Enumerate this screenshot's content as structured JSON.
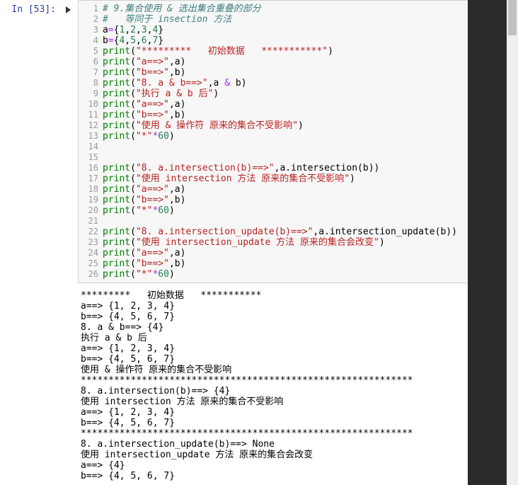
{
  "prompt": {
    "label": "In [53]:"
  },
  "code_lines": [
    {
      "n": "1",
      "html": "<span class='c'># 9.集合使用 &amp; 选出集合重叠的部分</span>"
    },
    {
      "n": "2",
      "html": "<span class='c'>#   等同于 insection 方法</span>"
    },
    {
      "n": "3",
      "html": "<span class='n'>a</span><span class='o'>=</span><span class='p'>{</span><span class='mi'>1</span><span class='p'>,</span><span class='mi'>2</span><span class='p'>,</span><span class='mi'>3</span><span class='p'>,</span><span class='mi'>4</span><span class='p'>}</span>"
    },
    {
      "n": "4",
      "html": "<span class='n'>b</span><span class='o'>=</span><span class='p'>{</span><span class='mi'>4</span><span class='p'>,</span><span class='mi'>5</span><span class='p'>,</span><span class='mi'>6</span><span class='p'>,</span><span class='mi'>7</span><span class='p'>}</span>"
    },
    {
      "n": "5",
      "html": "<span class='bp'>print</span><span class='p'>(</span><span class='s'>\"*********   初始数据   ***********\"</span><span class='p'>)</span>"
    },
    {
      "n": "6",
      "html": "<span class='bp'>print</span><span class='p'>(</span><span class='s'>\"a==&gt;\"</span><span class='p'>,</span><span class='n'>a</span><span class='p'>)</span>"
    },
    {
      "n": "7",
      "html": "<span class='bp'>print</span><span class='p'>(</span><span class='s'>\"b==&gt;\"</span><span class='p'>,</span><span class='n'>b</span><span class='p'>)</span>"
    },
    {
      "n": "8",
      "html": "<span class='bp'>print</span><span class='p'>(</span><span class='s'>\"8. a &amp; b==&gt;\"</span><span class='p'>,</span><span class='n'>a</span> <span class='o'>&amp;</span> <span class='n'>b</span><span class='p'>)</span>"
    },
    {
      "n": "9",
      "html": "<span class='bp'>print</span><span class='p'>(</span><span class='s'>\"执行 a &amp; b 后\"</span><span class='p'>)</span>"
    },
    {
      "n": "10",
      "html": "<span class='bp'>print</span><span class='p'>(</span><span class='s'>\"a==&gt;\"</span><span class='p'>,</span><span class='n'>a</span><span class='p'>)</span>"
    },
    {
      "n": "11",
      "html": "<span class='bp'>print</span><span class='p'>(</span><span class='s'>\"b==&gt;\"</span><span class='p'>,</span><span class='n'>b</span><span class='p'>)</span>"
    },
    {
      "n": "12",
      "html": "<span class='bp'>print</span><span class='p'>(</span><span class='s'>\"使用 &amp; 操作符 原来的集合不受影响\"</span><span class='p'>)</span>"
    },
    {
      "n": "13",
      "html": "<span class='bp'>print</span><span class='p'>(</span><span class='s'>\"*\"</span><span class='o'>*</span><span class='mi'>60</span><span class='p'>)</span>"
    },
    {
      "n": "14",
      "html": ""
    },
    {
      "n": "15",
      "html": ""
    },
    {
      "n": "16",
      "html": "<span class='bp'>print</span><span class='p'>(</span><span class='s'>\"8. a.intersection(b)==&gt;\"</span><span class='p'>,</span><span class='n'>a</span><span class='p'>.</span><span class='n'>intersection</span><span class='p'>(</span><span class='n'>b</span><span class='p'>))</span>"
    },
    {
      "n": "17",
      "html": "<span class='bp'>print</span><span class='p'>(</span><span class='s'>\"使用 intersection 方法 原来的集合不受影响\"</span><span class='p'>)</span>"
    },
    {
      "n": "18",
      "html": "<span class='bp'>print</span><span class='p'>(</span><span class='s'>\"a==&gt;\"</span><span class='p'>,</span><span class='n'>a</span><span class='p'>)</span>"
    },
    {
      "n": "19",
      "html": "<span class='bp'>print</span><span class='p'>(</span><span class='s'>\"b==&gt;\"</span><span class='p'>,</span><span class='n'>b</span><span class='p'>)</span>"
    },
    {
      "n": "20",
      "html": "<span class='bp'>print</span><span class='p'>(</span><span class='s'>\"*\"</span><span class='o'>*</span><span class='mi'>60</span><span class='p'>)</span>"
    },
    {
      "n": "21",
      "html": ""
    },
    {
      "n": "22",
      "html": "<span class='bp'>print</span><span class='p'>(</span><span class='s'>\"8. a.intersection_update(b)==&gt;\"</span><span class='p'>,</span><span class='n'>a</span><span class='p'>.</span><span class='n'>intersection_update</span><span class='p'>(</span><span class='n'>b</span><span class='p'>))</span>"
    },
    {
      "n": "23",
      "html": "<span class='bp'>print</span><span class='p'>(</span><span class='s'>\"使用 intersection_update 方法 原来的集合会改变\"</span><span class='p'>)</span>"
    },
    {
      "n": "24",
      "html": "<span class='bp'>print</span><span class='p'>(</span><span class='s'>\"a==&gt;\"</span><span class='p'>,</span><span class='n'>a</span><span class='p'>)</span>"
    },
    {
      "n": "25",
      "html": "<span class='bp'>print</span><span class='p'>(</span><span class='s'>\"b==&gt;\"</span><span class='p'>,</span><span class='n'>b</span><span class='p'>)</span>"
    },
    {
      "n": "26",
      "html": "<span class='bp'>print</span><span class='p'>(</span><span class='s'>\"*\"</span><span class='o'>*</span><span class='mi'>60</span><span class='p'>)</span>"
    }
  ],
  "output_lines": [
    "*********   初始数据   ***********",
    "a==> {1, 2, 3, 4}",
    "b==> {4, 5, 6, 7}",
    "8. a & b==> {4}",
    "执行 a & b 后",
    "a==> {1, 2, 3, 4}",
    "b==> {4, 5, 6, 7}",
    "使用 & 操作符 原来的集合不受影响",
    "************************************************************",
    "8. a.intersection(b)==> {4}",
    "使用 intersection 方法 原来的集合不受影响",
    "a==> {1, 2, 3, 4}",
    "b==> {4, 5, 6, 7}",
    "************************************************************",
    "8. a.intersection_update(b)==> None",
    "使用 intersection_update 方法 原来的集合会改变",
    "a==> {4}",
    "b==> {4, 5, 6, 7}"
  ]
}
